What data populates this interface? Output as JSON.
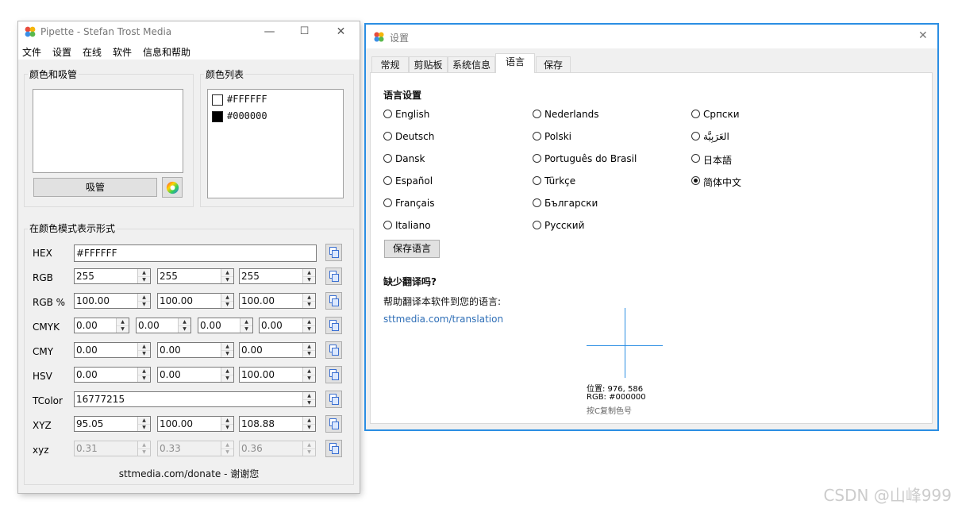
{
  "main_window": {
    "title": "Pipette - Stefan Trost Media",
    "controls": {
      "minimize": "—",
      "maximize": "☐",
      "close": "✕"
    },
    "menu": [
      "文件",
      "设置",
      "在线",
      "软件",
      "信息和帮助"
    ],
    "color_group": {
      "label": "颜色和吸管",
      "pick_button": "吸管",
      "swatch_color": "#FFFFFF"
    },
    "list_group": {
      "label": "颜色列表",
      "items": [
        {
          "text": "#FFFFFF",
          "color": "#FFFFFF"
        },
        {
          "text": "#000000",
          "color": "#000000"
        }
      ]
    },
    "formats_group": {
      "label": "在颜色模式表示形式",
      "hex": {
        "label": "HEX",
        "value": "#FFFFFF"
      },
      "rgb": {
        "label": "RGB",
        "values": [
          "255",
          "255",
          "255"
        ]
      },
      "rgb_pct": {
        "label": "RGB %",
        "values": [
          "100.00",
          "100.00",
          "100.00"
        ]
      },
      "cmyk": {
        "label": "CMYK",
        "values": [
          "0.00",
          "0.00",
          "0.00",
          "0.00"
        ]
      },
      "cmy": {
        "label": "CMY",
        "values": [
          "0.00",
          "0.00",
          "0.00"
        ]
      },
      "hsv": {
        "label": "HSV",
        "values": [
          "0.00",
          "0.00",
          "100.00"
        ]
      },
      "tcolor": {
        "label": "TColor",
        "value": "16777215"
      },
      "xyz": {
        "label": "XYZ",
        "values": [
          "95.05",
          "100.00",
          "108.88"
        ]
      },
      "xyz_small": {
        "label": "xyz",
        "values": [
          "0.31",
          "0.33",
          "0.36"
        ]
      }
    },
    "footer": "sttmedia.com/donate - 谢谢您"
  },
  "settings_window": {
    "title": "设置",
    "close": "✕",
    "tabs": [
      "常规",
      "剪贴板",
      "系统信息",
      "语言",
      "保存"
    ],
    "active_tab": "语言",
    "section_title": "语言设置",
    "languages_col1": [
      "English",
      "Deutsch",
      "Dansk",
      "Español",
      "Français",
      "Italiano"
    ],
    "languages_col2": [
      "Nederlands",
      "Polski",
      "Português do Brasil",
      "Türkçe",
      "Български",
      "Русский"
    ],
    "languages_col3": [
      "Српски",
      "العَرَبِيَّة",
      "日本語",
      "简体中文"
    ],
    "selected_language": "简体中文",
    "save_button": "保存语言",
    "missing_title": "缺少翻译吗?",
    "missing_text": "帮助翻译本软件到您的语言:",
    "link": "sttmedia.com/translation",
    "cursor_tip": {
      "position": "位置: 976, 586",
      "rgb": "RGB: #000000",
      "hint": "按C复制色号"
    },
    "accent": "#2B8EE3"
  },
  "watermark": "CSDN @山峰999"
}
